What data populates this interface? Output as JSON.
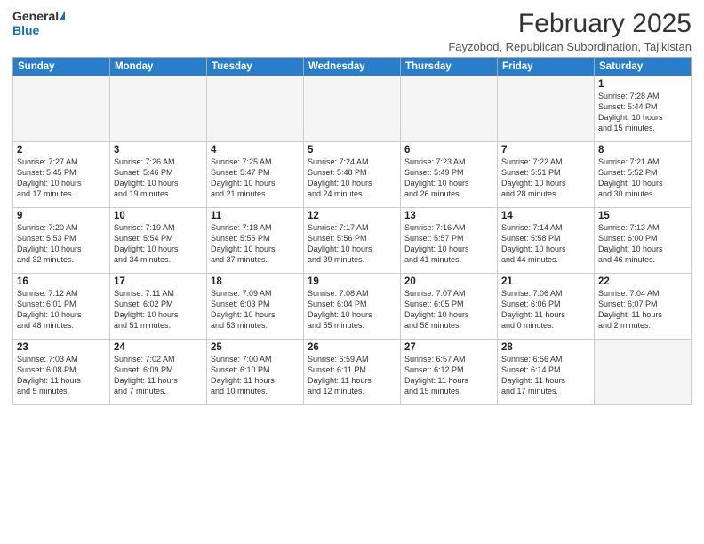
{
  "header": {
    "logo_general": "General",
    "logo_blue": "Blue",
    "month_year": "February 2025",
    "location": "Fayzobod, Republican Subordination, Tajikistan"
  },
  "weekdays": [
    "Sunday",
    "Monday",
    "Tuesday",
    "Wednesday",
    "Thursday",
    "Friday",
    "Saturday"
  ],
  "weeks": [
    [
      {
        "day": "",
        "info": ""
      },
      {
        "day": "",
        "info": ""
      },
      {
        "day": "",
        "info": ""
      },
      {
        "day": "",
        "info": ""
      },
      {
        "day": "",
        "info": ""
      },
      {
        "day": "",
        "info": ""
      },
      {
        "day": "1",
        "info": "Sunrise: 7:28 AM\nSunset: 5:44 PM\nDaylight: 10 hours\nand 15 minutes."
      }
    ],
    [
      {
        "day": "2",
        "info": "Sunrise: 7:27 AM\nSunset: 5:45 PM\nDaylight: 10 hours\nand 17 minutes."
      },
      {
        "day": "3",
        "info": "Sunrise: 7:26 AM\nSunset: 5:46 PM\nDaylight: 10 hours\nand 19 minutes."
      },
      {
        "day": "4",
        "info": "Sunrise: 7:25 AM\nSunset: 5:47 PM\nDaylight: 10 hours\nand 21 minutes."
      },
      {
        "day": "5",
        "info": "Sunrise: 7:24 AM\nSunset: 5:48 PM\nDaylight: 10 hours\nand 24 minutes."
      },
      {
        "day": "6",
        "info": "Sunrise: 7:23 AM\nSunset: 5:49 PM\nDaylight: 10 hours\nand 26 minutes."
      },
      {
        "day": "7",
        "info": "Sunrise: 7:22 AM\nSunset: 5:51 PM\nDaylight: 10 hours\nand 28 minutes."
      },
      {
        "day": "8",
        "info": "Sunrise: 7:21 AM\nSunset: 5:52 PM\nDaylight: 10 hours\nand 30 minutes."
      }
    ],
    [
      {
        "day": "9",
        "info": "Sunrise: 7:20 AM\nSunset: 5:53 PM\nDaylight: 10 hours\nand 32 minutes."
      },
      {
        "day": "10",
        "info": "Sunrise: 7:19 AM\nSunset: 5:54 PM\nDaylight: 10 hours\nand 34 minutes."
      },
      {
        "day": "11",
        "info": "Sunrise: 7:18 AM\nSunset: 5:55 PM\nDaylight: 10 hours\nand 37 minutes."
      },
      {
        "day": "12",
        "info": "Sunrise: 7:17 AM\nSunset: 5:56 PM\nDaylight: 10 hours\nand 39 minutes."
      },
      {
        "day": "13",
        "info": "Sunrise: 7:16 AM\nSunset: 5:57 PM\nDaylight: 10 hours\nand 41 minutes."
      },
      {
        "day": "14",
        "info": "Sunrise: 7:14 AM\nSunset: 5:58 PM\nDaylight: 10 hours\nand 44 minutes."
      },
      {
        "day": "15",
        "info": "Sunrise: 7:13 AM\nSunset: 6:00 PM\nDaylight: 10 hours\nand 46 minutes."
      }
    ],
    [
      {
        "day": "16",
        "info": "Sunrise: 7:12 AM\nSunset: 6:01 PM\nDaylight: 10 hours\nand 48 minutes."
      },
      {
        "day": "17",
        "info": "Sunrise: 7:11 AM\nSunset: 6:02 PM\nDaylight: 10 hours\nand 51 minutes."
      },
      {
        "day": "18",
        "info": "Sunrise: 7:09 AM\nSunset: 6:03 PM\nDaylight: 10 hours\nand 53 minutes."
      },
      {
        "day": "19",
        "info": "Sunrise: 7:08 AM\nSunset: 6:04 PM\nDaylight: 10 hours\nand 55 minutes."
      },
      {
        "day": "20",
        "info": "Sunrise: 7:07 AM\nSunset: 6:05 PM\nDaylight: 10 hours\nand 58 minutes."
      },
      {
        "day": "21",
        "info": "Sunrise: 7:06 AM\nSunset: 6:06 PM\nDaylight: 11 hours\nand 0 minutes."
      },
      {
        "day": "22",
        "info": "Sunrise: 7:04 AM\nSunset: 6:07 PM\nDaylight: 11 hours\nand 2 minutes."
      }
    ],
    [
      {
        "day": "23",
        "info": "Sunrise: 7:03 AM\nSunset: 6:08 PM\nDaylight: 11 hours\nand 5 minutes."
      },
      {
        "day": "24",
        "info": "Sunrise: 7:02 AM\nSunset: 6:09 PM\nDaylight: 11 hours\nand 7 minutes."
      },
      {
        "day": "25",
        "info": "Sunrise: 7:00 AM\nSunset: 6:10 PM\nDaylight: 11 hours\nand 10 minutes."
      },
      {
        "day": "26",
        "info": "Sunrise: 6:59 AM\nSunset: 6:11 PM\nDaylight: 11 hours\nand 12 minutes."
      },
      {
        "day": "27",
        "info": "Sunrise: 6:57 AM\nSunset: 6:12 PM\nDaylight: 11 hours\nand 15 minutes."
      },
      {
        "day": "28",
        "info": "Sunrise: 6:56 AM\nSunset: 6:14 PM\nDaylight: 11 hours\nand 17 minutes."
      },
      {
        "day": "",
        "info": ""
      }
    ]
  ]
}
